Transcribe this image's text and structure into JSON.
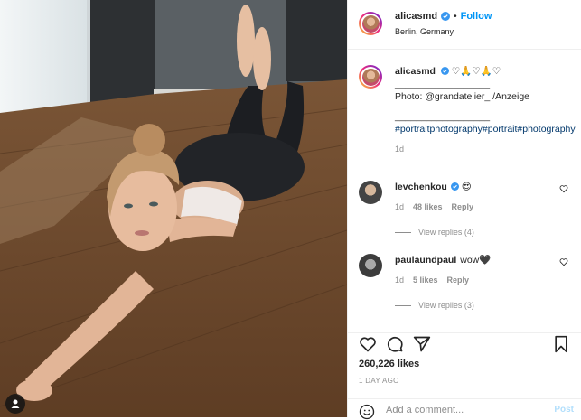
{
  "post": {
    "username": "alicasmd",
    "location": "Berlin, Germany",
    "follow_label": "Follow",
    "separator": "•"
  },
  "caption": {
    "username": "alicasmd",
    "emojis": "♡🙏♡🙏♡",
    "divider1": "__________________",
    "line_photo": "Photo: @grandatelier_ /Anzeige",
    "divider2": "__________________",
    "hashtags": "#portraitphotography#portrait#photography",
    "time": "1d"
  },
  "comments": [
    {
      "username": "levchenkou",
      "text": "😍",
      "time": "1d",
      "likes": "48 likes",
      "reply": "Reply",
      "view_replies": "View replies (4)"
    },
    {
      "username": "paulaundpaul",
      "text": "wow🖤",
      "time": "1d",
      "likes": "5 likes",
      "reply": "Reply",
      "view_replies": "View replies (3)"
    }
  ],
  "engagement": {
    "likes": "260,226 likes",
    "date": "1 DAY AGO"
  },
  "comment_box": {
    "placeholder": "Add a comment...",
    "post_label": "Post"
  },
  "icons": {
    "like": "heart-icon",
    "comment": "comment-icon",
    "share": "paper-plane-icon",
    "save": "bookmark-icon",
    "emoji": "smiley-icon",
    "verified": "verified-badge-icon",
    "user_tag": "person-tag-icon"
  },
  "colors": {
    "accent": "#0095f6",
    "text": "#262626",
    "muted": "#8e8e8e",
    "link": "#00376b",
    "post_disabled": "#b2dffc"
  }
}
